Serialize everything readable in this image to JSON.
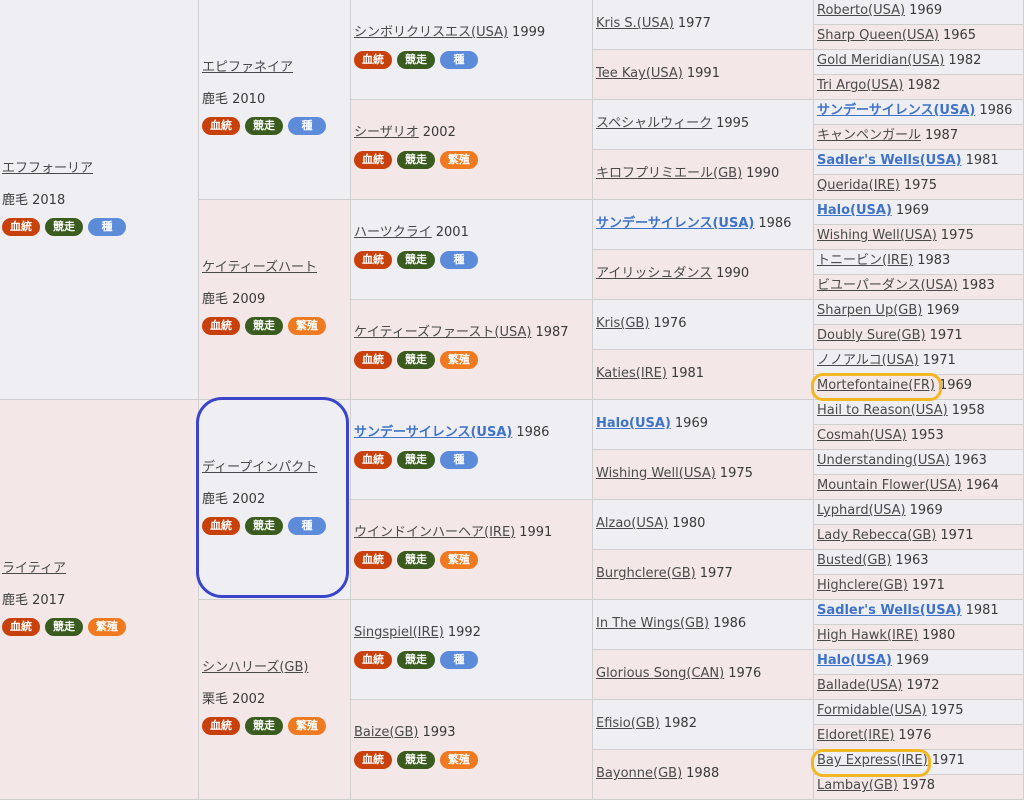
{
  "labels": {
    "blood": "血統",
    "race": "競走",
    "stud": "種",
    "breed": "繁殖"
  },
  "colors": {
    "blood": "#c8410d",
    "race": "#3a5c1f",
    "stud": "#5b8bd9",
    "breed": "#f07a1f",
    "circle": "#3b45c9",
    "pill": "#f2b824"
  },
  "gen1": [
    {
      "name": "エフフォーリア",
      "coat": "鹿毛 2018",
      "sex": "male",
      "bold": false
    },
    {
      "name": "ライティア",
      "coat": "鹿毛 2017",
      "sex": "female",
      "bold": false
    }
  ],
  "gen2": [
    {
      "name": "エピファネイア",
      "coat": "鹿毛 2010",
      "sex": "male"
    },
    {
      "name": "ケイティーズハート",
      "coat": "鹿毛 2009",
      "sex": "female"
    },
    {
      "name": "ディープインパクト",
      "coat": "鹿毛 2002",
      "sex": "male"
    },
    {
      "name": "シンハリーズ(GB)",
      "coat": "栗毛 2002",
      "sex": "female"
    }
  ],
  "gen3": [
    {
      "name": "シンボリクリスエス(USA)",
      "year": "1999",
      "sex": "male",
      "bold": false
    },
    {
      "name": "シーザリオ",
      "year": "2002",
      "sex": "female",
      "bold": false
    },
    {
      "name": "ハーツクライ",
      "year": "2001",
      "sex": "male",
      "bold": false
    },
    {
      "name": "ケイティーズファースト(USA)",
      "year": "1987",
      "sex": "female",
      "bold": false
    },
    {
      "name": "サンデーサイレンス(USA)",
      "year": "1986",
      "sex": "male",
      "bold": true
    },
    {
      "name": "ウインドインハーヘア(IRE)",
      "year": "1991",
      "sex": "female",
      "bold": false
    },
    {
      "name": "Singspiel(IRE)",
      "year": "1992",
      "sex": "male",
      "bold": false
    },
    {
      "name": "Baize(GB)",
      "year": "1993",
      "sex": "female",
      "bold": false
    }
  ],
  "gen4": [
    {
      "name": "Kris S.(USA)",
      "year": "1977",
      "sex": "male",
      "bold": false
    },
    {
      "name": "Tee Kay(USA)",
      "year": "1991",
      "sex": "female",
      "bold": false
    },
    {
      "name": "スペシャルウィーク",
      "year": "1995",
      "sex": "male",
      "bold": false
    },
    {
      "name": "キロフプリミエール(GB)",
      "year": "1990",
      "sex": "female",
      "bold": false
    },
    {
      "name": "サンデーサイレンス(USA)",
      "year": "1986",
      "sex": "male",
      "bold": true
    },
    {
      "name": "アイリッシュダンス",
      "year": "1990",
      "sex": "female",
      "bold": false
    },
    {
      "name": "Kris(GB)",
      "year": "1976",
      "sex": "male",
      "bold": false
    },
    {
      "name": "Katies(IRE)",
      "year": "1981",
      "sex": "female",
      "bold": false
    },
    {
      "name": "Halo(USA)",
      "year": "1969",
      "sex": "male",
      "bold": true
    },
    {
      "name": "Wishing Well(USA)",
      "year": "1975",
      "sex": "female",
      "bold": false
    },
    {
      "name": "Alzao(USA)",
      "year": "1980",
      "sex": "male",
      "bold": false
    },
    {
      "name": "Burghclere(GB)",
      "year": "1977",
      "sex": "female",
      "bold": false
    },
    {
      "name": "In The Wings(GB)",
      "year": "1986",
      "sex": "male",
      "bold": false
    },
    {
      "name": "Glorious Song(CAN)",
      "year": "1976",
      "sex": "female",
      "bold": false
    },
    {
      "name": "Efisio(GB)",
      "year": "1982",
      "sex": "male",
      "bold": false
    },
    {
      "name": "Bayonne(GB)",
      "year": "1988",
      "sex": "female",
      "bold": false
    }
  ],
  "gen5": [
    {
      "name": "Roberto(USA)",
      "year": "1969",
      "sex": "male",
      "bold": false
    },
    {
      "name": "Sharp Queen(USA)",
      "year": "1965",
      "sex": "female",
      "bold": false
    },
    {
      "name": "Gold Meridian(USA)",
      "year": "1982",
      "sex": "male",
      "bold": false
    },
    {
      "name": "Tri Argo(USA)",
      "year": "1982",
      "sex": "female",
      "bold": false
    },
    {
      "name": "サンデーサイレンス(USA)",
      "year": "1986",
      "sex": "male",
      "bold": true
    },
    {
      "name": "キャンペンガール",
      "year": "1987",
      "sex": "female",
      "bold": false
    },
    {
      "name": "Sadler's Wells(USA)",
      "year": "1981",
      "sex": "male",
      "bold": true
    },
    {
      "name": "Querida(IRE)",
      "year": "1975",
      "sex": "female",
      "bold": false
    },
    {
      "name": "Halo(USA)",
      "year": "1969",
      "sex": "male",
      "bold": true
    },
    {
      "name": "Wishing Well(USA)",
      "year": "1975",
      "sex": "female",
      "bold": false
    },
    {
      "name": "トニービン(IRE)",
      "year": "1983",
      "sex": "male",
      "bold": false
    },
    {
      "name": "ビユーパーダンス(USA)",
      "year": "1983",
      "sex": "female",
      "bold": false
    },
    {
      "name": "Sharpen Up(GB)",
      "year": "1969",
      "sex": "male",
      "bold": false
    },
    {
      "name": "Doubly Sure(GB)",
      "year": "1971",
      "sex": "female",
      "bold": false
    },
    {
      "name": "ノノアルコ(USA)",
      "year": "1971",
      "sex": "male",
      "bold": false
    },
    {
      "name": "Mortefontaine(FR)",
      "year": "1969",
      "sex": "female",
      "bold": false
    },
    {
      "name": "Hail to Reason(USA)",
      "year": "1958",
      "sex": "male",
      "bold": false
    },
    {
      "name": "Cosmah(USA)",
      "year": "1953",
      "sex": "female",
      "bold": false
    },
    {
      "name": "Understanding(USA)",
      "year": "1963",
      "sex": "male",
      "bold": false
    },
    {
      "name": "Mountain Flower(USA)",
      "year": "1964",
      "sex": "female",
      "bold": false
    },
    {
      "name": "Lyphard(USA)",
      "year": "1969",
      "sex": "male",
      "bold": false
    },
    {
      "name": "Lady Rebecca(GB)",
      "year": "1971",
      "sex": "female",
      "bold": false
    },
    {
      "name": "Busted(GB)",
      "year": "1963",
      "sex": "male",
      "bold": false
    },
    {
      "name": "Highclere(GB)",
      "year": "1971",
      "sex": "female",
      "bold": false
    },
    {
      "name": "Sadler's Wells(USA)",
      "year": "1981",
      "sex": "male",
      "bold": true
    },
    {
      "name": "High Hawk(IRE)",
      "year": "1980",
      "sex": "female",
      "bold": false
    },
    {
      "name": "Halo(USA)",
      "year": "1969",
      "sex": "male",
      "bold": true
    },
    {
      "name": "Ballade(USA)",
      "year": "1972",
      "sex": "female",
      "bold": false
    },
    {
      "name": "Formidable(USA)",
      "year": "1975",
      "sex": "male",
      "bold": false
    },
    {
      "name": "Eldoret(IRE)",
      "year": "1976",
      "sex": "female",
      "bold": false
    },
    {
      "name": "Bay Express(IRE)",
      "year": "1971",
      "sex": "male",
      "bold": false
    },
    {
      "name": "Lambay(GB)",
      "year": "1978",
      "sex": "female",
      "bold": false
    }
  ]
}
